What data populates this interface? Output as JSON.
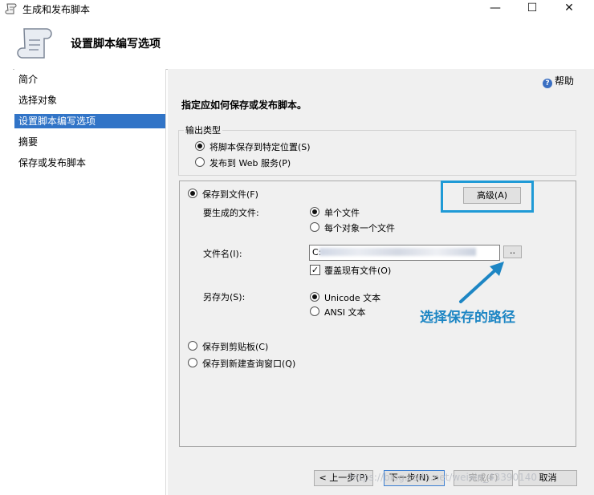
{
  "window": {
    "title": "生成和发布脚本",
    "controls": {
      "minimize": "—",
      "maximize": "☐",
      "close": "✕"
    }
  },
  "header": {
    "title": "设置脚本编写选项"
  },
  "sidebar": {
    "items": [
      {
        "label": "简介",
        "selected": false
      },
      {
        "label": "选择对象",
        "selected": false
      },
      {
        "label": "设置脚本编写选项",
        "selected": true
      },
      {
        "label": "摘要",
        "selected": false
      },
      {
        "label": "保存或发布脚本",
        "selected": false
      }
    ]
  },
  "help": {
    "label": "帮助"
  },
  "main": {
    "instruction": "指定应如何保存或发布脚本。",
    "output_type": {
      "legend": "输出类型",
      "options": [
        {
          "label": "将脚本保存到特定位置(S)",
          "selected": true
        },
        {
          "label": "发布到 Web 服务(P)",
          "selected": false
        }
      ]
    },
    "save_to_file": {
      "label": "保存到文件(F)",
      "selected": true,
      "advanced_button": "高级(A)",
      "files_to_generate": {
        "label": "要生成的文件:",
        "options": [
          {
            "label": "单个文件",
            "selected": true
          },
          {
            "label": "每个对象一个文件",
            "selected": false
          }
        ]
      },
      "file_name": {
        "label": "文件名(I):",
        "value": "C:",
        "browse": "..",
        "overwrite": {
          "label": "覆盖现有文件(O)",
          "checked": true
        }
      },
      "save_as": {
        "label": "另存为(S):",
        "options": [
          {
            "label": "Unicode 文本",
            "selected": true
          },
          {
            "label": "ANSI 文本",
            "selected": false
          }
        ]
      }
    },
    "save_to_clipboard": {
      "label": "保存到剪贴板(C)",
      "selected": false
    },
    "save_to_query_window": {
      "label": "保存到新建查询窗口(Q)",
      "selected": false
    }
  },
  "annotation": {
    "text": "选择保存的路径",
    "color": "#1d86c4"
  },
  "footer": {
    "prev": "< 上一步(P)",
    "next": "下一步(N) >",
    "finish": "完成(F)",
    "cancel": "取消"
  },
  "watermark": "https://blog.csdn.net/weixin_43390140",
  "colors": {
    "selection": "#3174c7",
    "highlight_box": "#1f9ad6"
  }
}
